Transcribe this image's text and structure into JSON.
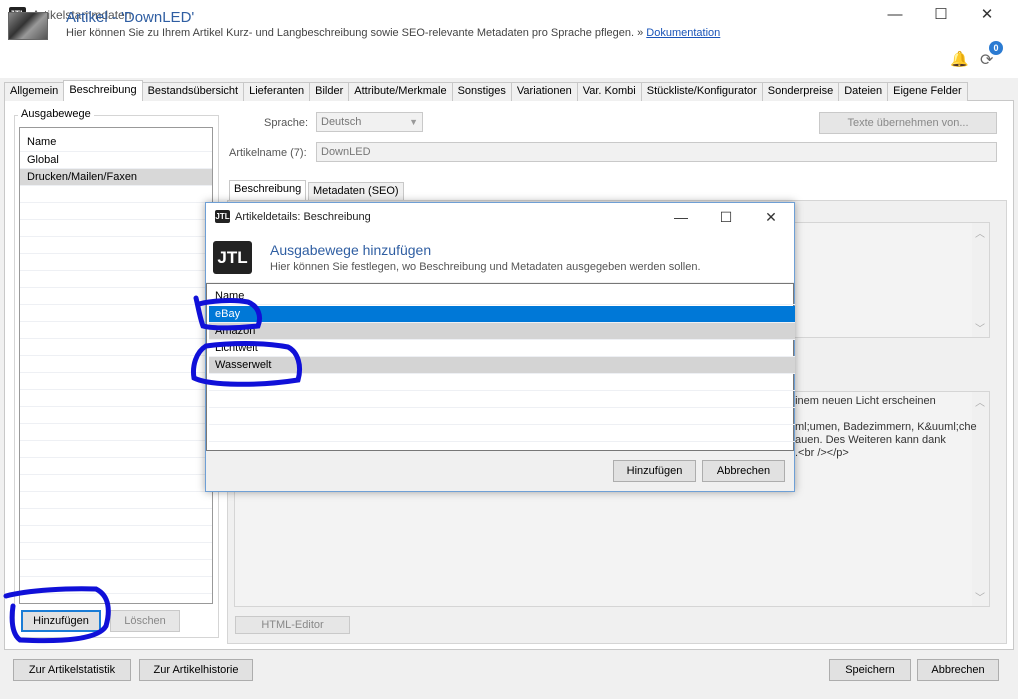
{
  "window": {
    "logo": "JTL",
    "title": "Artikelstammdaten",
    "controls": {
      "minimize": "—",
      "maximize": "☐",
      "close": "✕"
    }
  },
  "header": {
    "title": "Artikel - 'DownLED'",
    "subtitle": "Hier können Sie zu Ihrem Artikel Kurz- und Langbeschreibung sowie SEO-relevante Metadaten pro Sprache pflegen.",
    "link_prefix": "»",
    "link_text": "Dokumentation",
    "notification_count": "0"
  },
  "tabs": [
    "Allgemein",
    "Beschreibung",
    "Bestandsübersicht",
    "Lieferanten",
    "Bilder",
    "Attribute/Merkmale",
    "Sonstiges",
    "Variationen",
    "Var. Kombi",
    "Stückliste/Konfigurator",
    "Sonderpreise",
    "Dateien",
    "Eigene Felder"
  ],
  "ausgabewege": {
    "title": "Ausgabewege",
    "header": "Name",
    "items": [
      "Global",
      "Drucken/Mailen/Faxen"
    ],
    "add_button": "Hinzufügen",
    "delete_button": "Löschen"
  },
  "form": {
    "sprache_label": "Sprache:",
    "sprache_value": "Deutsch",
    "artikelname_label": "Artikelname (7):",
    "artikelname_value": "DownLED",
    "copy_button": "Texte übernehmen von...",
    "inner_tabs": [
      "Beschreibung",
      "Metadaten (SEO)"
    ],
    "html_editor_button": "HTML-Editor",
    "bg_lines": [
      "einem neuen Licht erscheinen",
      "ml;umen, Badezimmern, K&uuml;che",
      "auen. Des Weiteren kann dank",
      ".<br /></p>"
    ]
  },
  "bottom": {
    "statistik": "Zur Artikelstatistik",
    "historie": "Zur Artikelhistorie",
    "save": "Speichern",
    "cancel": "Abbrechen"
  },
  "dialog": {
    "logo": "JTL",
    "title": "Artikeldetails: Beschreibung",
    "heading": "Ausgabewege hinzufügen",
    "subheading": "Hier können Sie festlegen, wo Beschreibung und Metadaten ausgegeben werden sollen.",
    "column": "Name",
    "rows": [
      "eBay",
      "Amazon",
      "Lichtwelt",
      "Wasserwelt"
    ],
    "add_button": "Hinzufügen",
    "cancel_button": "Abbrechen"
  },
  "annotation_color": "#1010d8"
}
